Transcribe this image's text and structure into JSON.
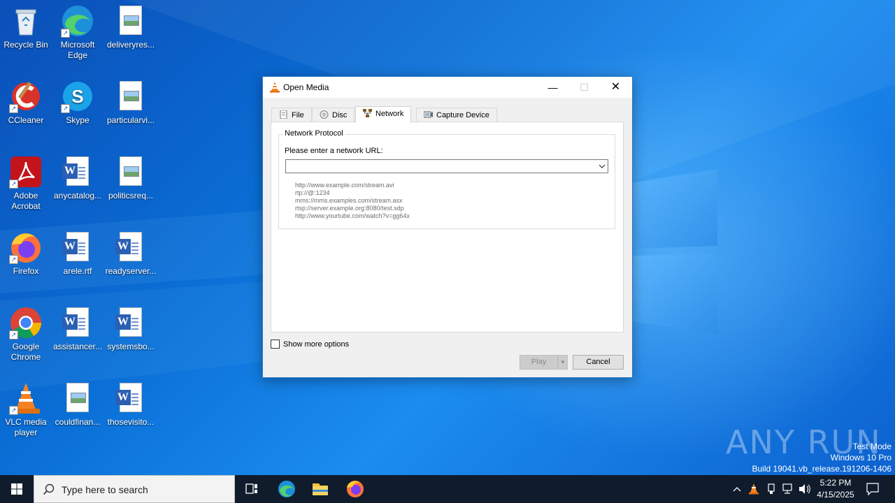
{
  "desktop": {
    "icons": [
      {
        "label": "Recycle Bin",
        "icon": "recycle-bin-icon"
      },
      {
        "label": "Microsoft Edge",
        "icon": "edge-icon"
      },
      {
        "label": "deliveryres...",
        "icon": "image-file-icon"
      },
      {
        "label": "CCleaner",
        "icon": "ccleaner-icon"
      },
      {
        "label": "Skype",
        "icon": "skype-icon"
      },
      {
        "label": "particularvi...",
        "icon": "image-file-icon"
      },
      {
        "label": "Adobe Acrobat",
        "icon": "acrobat-icon"
      },
      {
        "label": "anycatalog...",
        "icon": "word-doc-icon"
      },
      {
        "label": "politicsreq...",
        "icon": "image-file-icon"
      },
      {
        "label": "Firefox",
        "icon": "firefox-icon"
      },
      {
        "label": "arele.rtf",
        "icon": "word-doc-icon"
      },
      {
        "label": "readyserver...",
        "icon": "word-doc-icon"
      },
      {
        "label": "Google Chrome",
        "icon": "chrome-icon"
      },
      {
        "label": "assistancer...",
        "icon": "word-doc-icon"
      },
      {
        "label": "systemsbo...",
        "icon": "word-doc-icon"
      },
      {
        "label": "VLC media player",
        "icon": "vlc-icon"
      },
      {
        "label": "couldfinan...",
        "icon": "image-file-icon"
      },
      {
        "label": "thosevisito...",
        "icon": "word-doc-icon"
      }
    ]
  },
  "dialog": {
    "title": "Open Media",
    "minimize_glyph": "—",
    "maximize_glyph": "☐",
    "close_glyph": "✕",
    "tabs": [
      {
        "label": "File",
        "icon": "file-icon"
      },
      {
        "label": "Disc",
        "icon": "disc-icon"
      },
      {
        "label": "Network",
        "icon": "network-icon"
      },
      {
        "label": "Capture Device",
        "icon": "capture-device-icon"
      }
    ],
    "active_tab": "Network",
    "group_title": "Network Protocol",
    "url_label": "Please enter a network URL:",
    "url_value": "",
    "examples": [
      "http://www.example.com/stream.avi",
      "rtp://@:1234",
      "mms://mms.examples.com/stream.asx",
      "rtsp://server.example.org:8080/test.sdp",
      "http://www.yourtube.com/watch?v=gg64x"
    ],
    "show_more_options": "Show more options",
    "play_label": "Play",
    "play_drop_glyph": "▼",
    "cancel_label": "Cancel"
  },
  "watermark": {
    "brand": "ANY RUN",
    "lines": [
      "Test Mode",
      "Windows 10 Pro",
      "Build 19041.vb_release.191206-1406"
    ]
  },
  "taskbar": {
    "search_placeholder": "Type here to search",
    "apps": [
      "task-view-icon",
      "edge-icon",
      "file-explorer-icon",
      "firefox-icon"
    ],
    "tray": {
      "time": "5:22 PM",
      "date": "4/15/2025"
    }
  },
  "colors": {
    "accent": "#2c79c9",
    "taskbar": "#101c2c",
    "wallpaper": "#0a6fd6"
  }
}
